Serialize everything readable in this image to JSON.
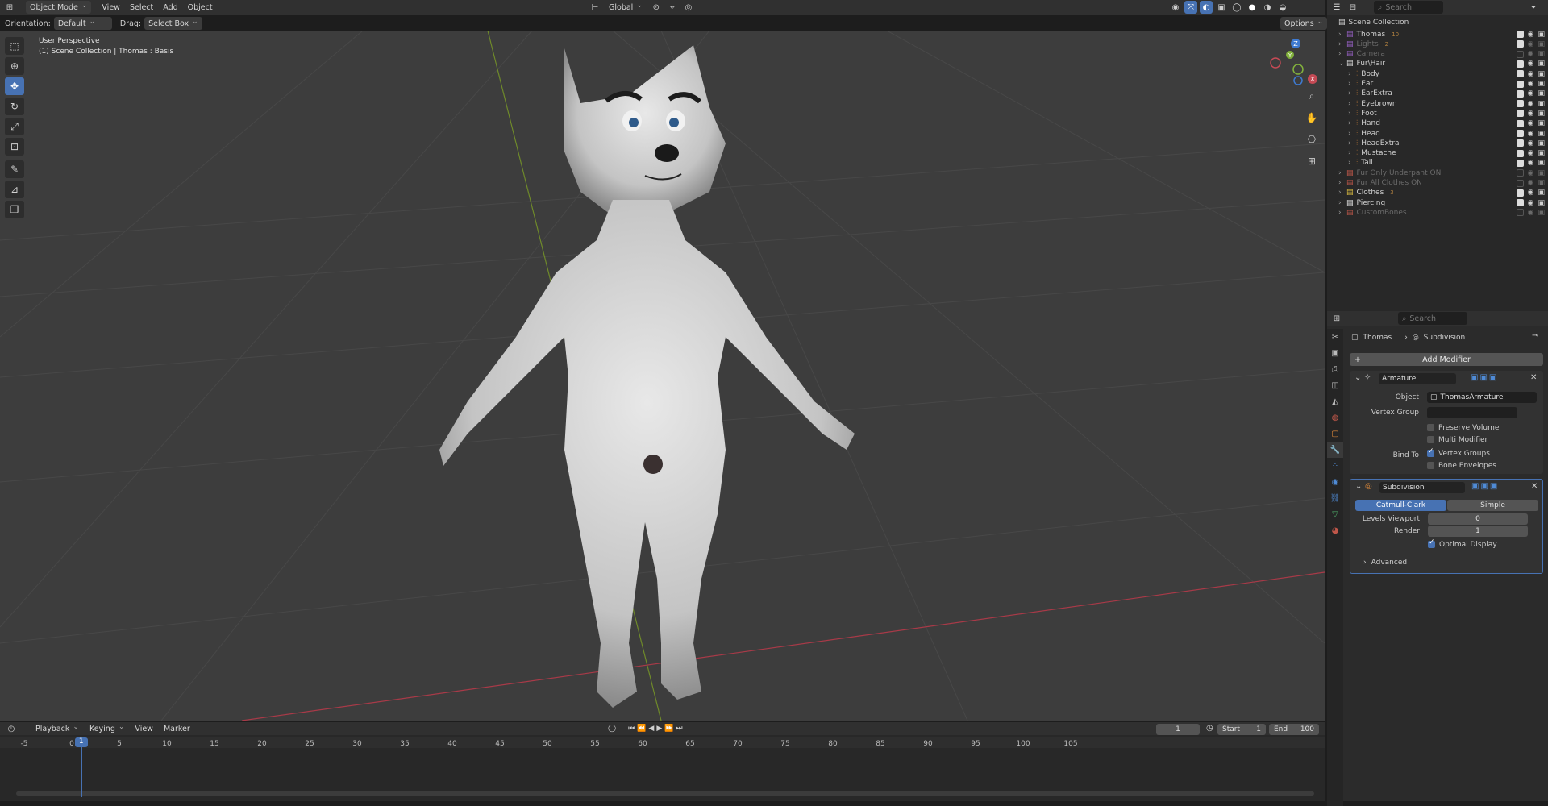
{
  "header": {
    "mode": "Object Mode",
    "menus": [
      "View",
      "Select",
      "Add",
      "Object"
    ],
    "transform_orientation": "Global",
    "options": "Options"
  },
  "toolsettings": {
    "orientation_label": "Orientation:",
    "orientation_value": "Default",
    "drag_label": "Drag:",
    "drag_value": "Select Box"
  },
  "viewport": {
    "perspective": "User Perspective",
    "context": "(1) Scene Collection | Thomas : Basis",
    "axes": {
      "x": "X",
      "y": "Y",
      "z": "Z"
    }
  },
  "outliner": {
    "search_placeholder": "Search",
    "root": "Scene Collection",
    "items": [
      {
        "label": "Thomas",
        "badge": "10"
      },
      {
        "label": "Lights",
        "badge": "2"
      },
      {
        "label": "Camera"
      },
      {
        "label": "Fur\\Hair"
      },
      {
        "label": "Body"
      },
      {
        "label": "Ear"
      },
      {
        "label": "EarExtra"
      },
      {
        "label": "Eyebrown"
      },
      {
        "label": "Foot"
      },
      {
        "label": "Hand"
      },
      {
        "label": "Head"
      },
      {
        "label": "HeadExtra"
      },
      {
        "label": "Mustache"
      },
      {
        "label": "Tail"
      },
      {
        "label": "Fur Only Underpant ON"
      },
      {
        "label": "Fur All Clothes ON"
      },
      {
        "label": "Clothes",
        "badge": "3"
      },
      {
        "label": "Piercing"
      },
      {
        "label": "CustomBones"
      }
    ]
  },
  "properties": {
    "search_placeholder": "Search",
    "breadcrumb_object": "Thomas",
    "breadcrumb_modifier": "Subdivision",
    "add_modifier": "Add Modifier",
    "armature": {
      "name": "Armature",
      "object_label": "Object",
      "object_value": "ThomasArmature",
      "vertex_group_label": "Vertex Group",
      "preserve_volume": "Preserve Volume",
      "multi_modifier": "Multi Modifier",
      "bind_to_label": "Bind To",
      "vertex_groups": "Vertex Groups",
      "bone_envelopes": "Bone Envelopes"
    },
    "subdivision": {
      "name": "Subdivision",
      "catmull": "Catmull-Clark",
      "simple": "Simple",
      "levels_viewport_label": "Levels Viewport",
      "levels_viewport_value": "0",
      "render_label": "Render",
      "render_value": "1",
      "optimal_display": "Optimal Display",
      "advanced": "Advanced"
    }
  },
  "timeline": {
    "menus": [
      "Playback",
      "Keying",
      "View",
      "Marker"
    ],
    "current_frame": "1",
    "start_label": "Start",
    "start_value": "1",
    "end_label": "End",
    "end_value": "100",
    "ticks": [
      "-5",
      "0",
      "5",
      "10",
      "15",
      "20",
      "25",
      "30",
      "35",
      "40",
      "45",
      "50",
      "55",
      "60",
      "65",
      "70",
      "75",
      "80",
      "85",
      "90",
      "95",
      "100",
      "105"
    ],
    "playhead_label": "1"
  }
}
